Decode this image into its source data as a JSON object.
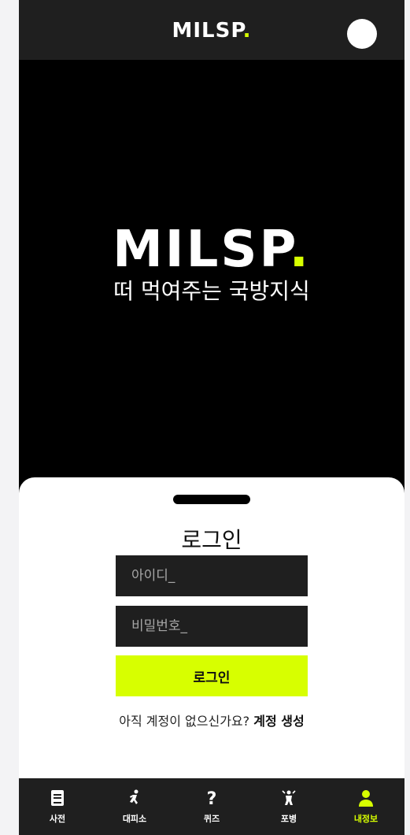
{
  "header": {
    "brand_text": "MILSP",
    "brand_dot": "."
  },
  "hero": {
    "logo_text": "MILSP",
    "logo_dot": ".",
    "tagline": "떠 먹여주는 국방지식"
  },
  "login": {
    "title": "로그인",
    "id_placeholder": "아이디_",
    "password_placeholder": "비밀번호_",
    "submit_label": "로그인",
    "no_account_text": "아직 계정이 없으신가요?",
    "create_account_label": "계정 생성"
  },
  "nav": {
    "items": [
      {
        "label": "사전",
        "icon": "book-icon"
      },
      {
        "label": "대피소",
        "icon": "running-person-icon"
      },
      {
        "label": "퀴즈",
        "icon": "question-mark-icon"
      },
      {
        "label": "포병",
        "icon": "soldier-icon"
      },
      {
        "label": "내정보",
        "icon": "user-icon",
        "active": true
      }
    ]
  },
  "colors": {
    "accent": "#d7ff00",
    "dark": "#1f1f1f",
    "background": "#000000"
  }
}
